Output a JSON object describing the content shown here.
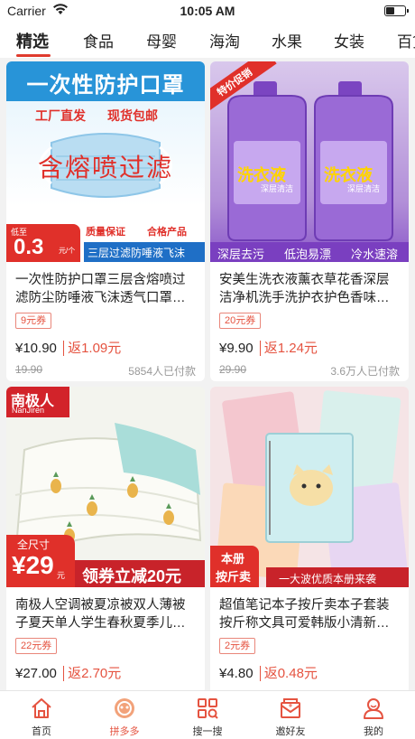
{
  "status": {
    "carrier": "Carrier",
    "time": "10:05 AM"
  },
  "tabs": [
    "精选",
    "食品",
    "母婴",
    "海淘",
    "水果",
    "女装",
    "百货"
  ],
  "products": [
    {
      "title": "一次性防护口罩三层含熔喷过滤防尘防唾液飞沫透气口罩…",
      "coupon": "9元券",
      "price": "¥10.90",
      "rebate": "返1.09元",
      "orig": "19.90",
      "sold": "5854人已付款",
      "image_text": {
        "headline": "一次性防护口罩",
        "tag1": "工厂直发",
        "tag2": "现货包邮",
        "mid": "含熔喷过滤",
        "low_label": "低至",
        "low_price": "0.3",
        "low_unit": "元/个",
        "q1": "质量保证",
        "q2": "合格产品",
        "banner": "三层过滤防唾液飞沫"
      }
    },
    {
      "title": "安美生洗衣液薰衣草花香深层洁净机洗手洗护衣护色香味…",
      "coupon": "20元券",
      "price": "¥9.90",
      "rebate": "返1.24元",
      "orig": "29.90",
      "sold": "3.6万人已付款",
      "image_text": {
        "ribbon": "特价促销",
        "bottle": "洗衣液",
        "bottle_sub": "深层清洁",
        "banner1": "深层去污",
        "banner2": "低泡易漂",
        "banner3": "冷水速溶"
      }
    },
    {
      "title": "南极人空调被夏凉被双人薄被子夏天单人学生春秋夏季儿…",
      "coupon": "22元券",
      "price": "¥27.00",
      "rebate": "返2.70元",
      "orig": "",
      "sold": "",
      "image_text": {
        "brand": "南极人",
        "brand_en": "NanJiren",
        "size": "全尺寸",
        "price": "¥29",
        "unit": "元",
        "promo": "领券立减20元"
      }
    },
    {
      "title": "超值笔记本子按斤卖本子套装按斤称文具可爱韩版小清新…",
      "coupon": "2元券",
      "price": "¥4.80",
      "rebate": "返0.48元",
      "orig": "",
      "sold": "",
      "image_text": {
        "corner1": "本册",
        "corner2": "按斤卖",
        "banner": "一大波优质本册来袭"
      }
    }
  ],
  "tabbar": [
    "首页",
    "拼多多",
    "搜一搜",
    "邀好友",
    "我的"
  ],
  "colors": {
    "accent": "#e55340",
    "mask_blue": "#1f8fd4",
    "lavender": "#8a58c9"
  }
}
